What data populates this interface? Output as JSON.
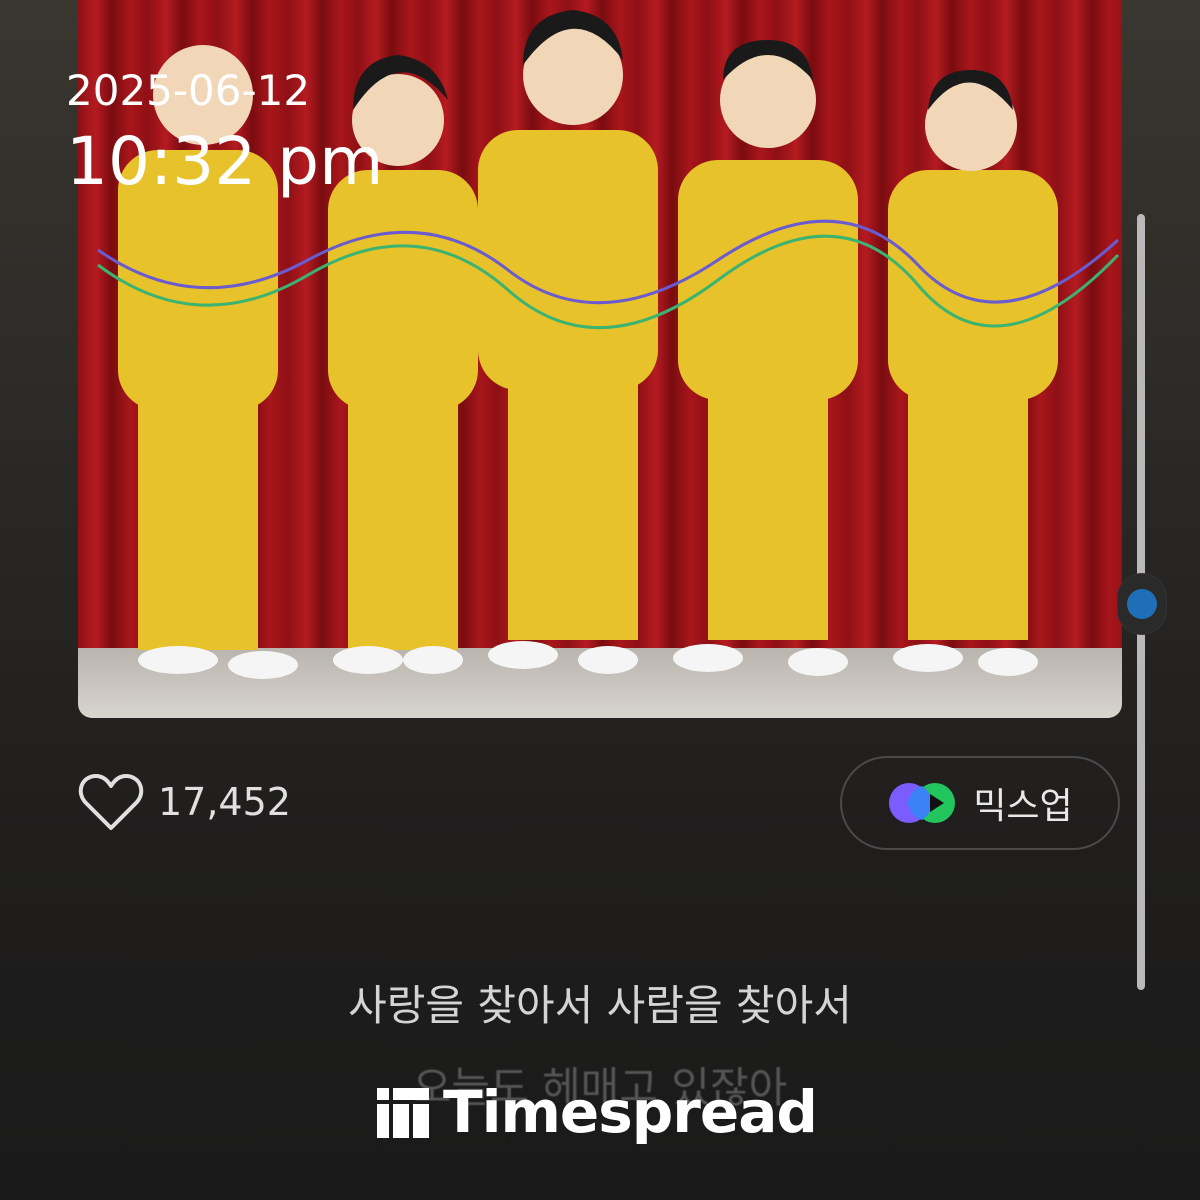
{
  "datetime": {
    "date": "2025-06-12",
    "time": "10:32 pm"
  },
  "album": {
    "image": "album-cover-photo"
  },
  "like": {
    "icon": "heart-outline-icon",
    "count": "17,452"
  },
  "mixup": {
    "icon": "mixup-logo-icon",
    "label": "믹스업",
    "colors": [
      "#7b5cff",
      "#22c55e"
    ]
  },
  "lyrics": {
    "current": "사랑을 찾아서 사람을 찾아서",
    "next": "오늘도 헤매고 있잖아"
  },
  "watermark": {
    "text": "Timespread"
  },
  "scrollbar": {
    "position": 0.47
  },
  "colors": {
    "scroll_dot": "#1f6fb8",
    "background": "#1f1e1d"
  }
}
